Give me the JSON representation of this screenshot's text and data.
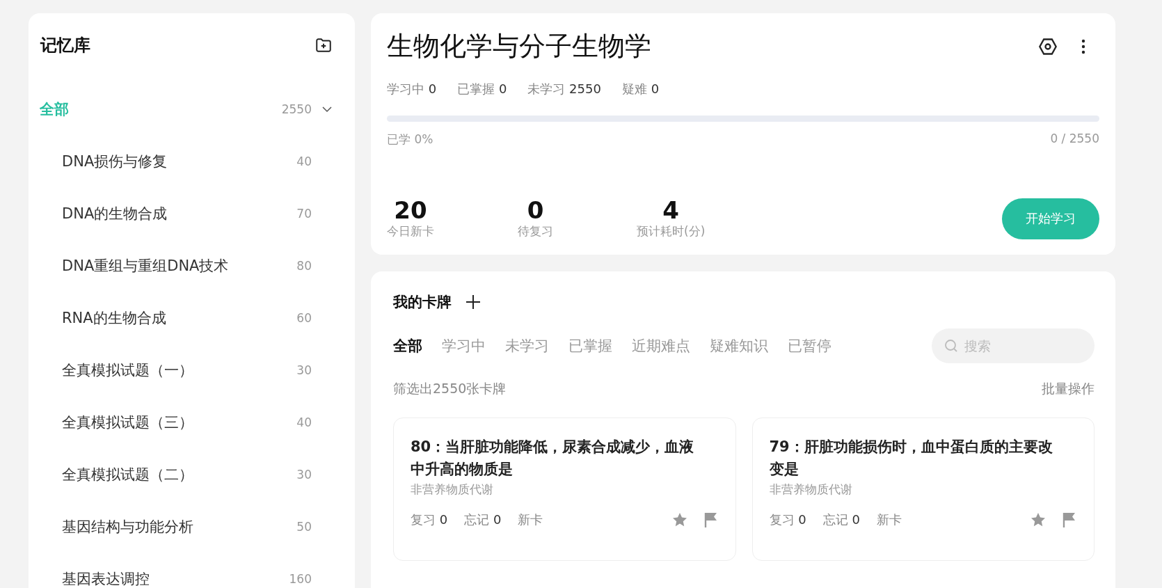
{
  "sidebar": {
    "title": "记忆库",
    "tree": [
      {
        "label": "全部",
        "count": "2550",
        "selected": true,
        "expanded": true,
        "children": [
          {
            "label": "DNA损伤与修复",
            "count": "40",
            "selected": false
          },
          {
            "label": "DNA的生物合成",
            "count": "70",
            "selected": false
          },
          {
            "label": "DNA重组与重组DNA技术",
            "count": "80",
            "selected": false
          },
          {
            "label": "RNA的生物合成",
            "count": "60",
            "selected": false
          },
          {
            "label": "全真模拟试题（一）",
            "count": "30",
            "selected": false
          },
          {
            "label": "全真模拟试题（三）",
            "count": "40",
            "selected": false
          },
          {
            "label": "全真模拟试题（二）",
            "count": "30",
            "selected": false
          },
          {
            "label": "基因结构与功能分析",
            "count": "50",
            "selected": false
          },
          {
            "label": "基因表达调控",
            "count": "160",
            "selected": false
          }
        ]
      }
    ]
  },
  "deck": {
    "title": "生物化学与分子生物学",
    "stats": [
      {
        "label": "学习中",
        "value": "0"
      },
      {
        "label": "已掌握",
        "value": "0"
      },
      {
        "label": "未学习",
        "value": "2550"
      },
      {
        "label": "疑难",
        "value": "0"
      }
    ],
    "progress": {
      "level": 0,
      "caption": "已学 0%",
      "reading": "0 / 2550"
    },
    "summary": [
      {
        "value": "20",
        "label": "今日新卡"
      },
      {
        "value": "0",
        "label": "待复习"
      },
      {
        "value": "4",
        "label": "预计耗时(分)"
      }
    ],
    "start_button": "开始学习"
  },
  "cards_panel": {
    "title": "我的卡牌",
    "tabs": [
      {
        "label": "全部",
        "selected": true
      },
      {
        "label": "学习中",
        "selected": false
      },
      {
        "label": "未学习",
        "selected": false
      },
      {
        "label": "已掌握",
        "selected": false
      },
      {
        "label": "近期难点",
        "selected": false
      },
      {
        "label": "疑难知识",
        "selected": false
      },
      {
        "label": "已暂停",
        "selected": false
      }
    ],
    "search": {
      "placeholder": "搜索"
    },
    "filter_text": "筛选出2550张卡牌",
    "batch_action": "批量操作",
    "cards": [
      {
        "title": "80：当肝脏功能降低，尿素合成减少，血液中升高的物质是",
        "category": "非营养物质代谢",
        "stats": [
          {
            "label": "复习",
            "value": "0"
          },
          {
            "label": "忘记",
            "value": "0"
          }
        ],
        "status": "新卡",
        "starred": false,
        "flagged": false
      },
      {
        "title": "79：肝脏功能损伤时，血中蛋白质的主要改变是",
        "category": "非营养物质代谢",
        "stats": [
          {
            "label": "复习",
            "value": "0"
          },
          {
            "label": "忘记",
            "value": "0"
          }
        ],
        "status": "新卡",
        "starred": false,
        "flagged": false
      }
    ]
  }
}
